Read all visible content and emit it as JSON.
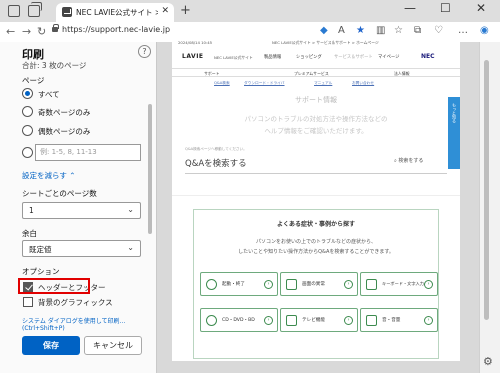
{
  "browser": {
    "tab_title": "NEC LAVIE公式サイト > サービス＆サ",
    "tab_close": "✕",
    "new_tab": "+",
    "url": "https://support.nec-lavie.jp",
    "win_min": "—",
    "win_max": "☐",
    "win_close": "✕",
    "nav_back": "←",
    "nav_forward": "→",
    "nav_reload": "↻",
    "more": "…"
  },
  "print": {
    "title": "印刷",
    "help": "?",
    "total": "合計: 3 枚のページ",
    "pages_label": "ページ",
    "opt_all": "すべて",
    "opt_odd": "奇数ページのみ",
    "opt_even": "偶数ページのみ",
    "custom_placeholder": "例: 1-5, 8, 11-13",
    "fewer_settings": "設定を減らす ⌃",
    "pages_per_sheet_label": "シートごとのページ数",
    "pages_per_sheet_value": "1",
    "margins_label": "余白",
    "margins_value": "既定値",
    "options_label": "オプション",
    "headers_footers": "ヘッダーとフッター",
    "background_graphics": "背景のグラフィックス",
    "system_dialog": "システム ダイアログを使用して印刷... (Ctrl+Shift+P)",
    "save": "保存",
    "cancel": "キャンセル"
  },
  "preview": {
    "top_left_date": "2024/08/14 10:45",
    "top_center": "NEC LAVIE公式サイト > サービス＆サポート > ホームページ",
    "brand": "LAVIE",
    "brand_sub": "NEC LAVIE公式サイト",
    "nav": [
      "製品情報",
      "ショッピング",
      "サービス＆サポート",
      "マイページ"
    ],
    "nec": "NEC",
    "sub_nav": [
      "サポート",
      "プレミアムサービス",
      "法人情報"
    ],
    "links": [
      "Q&A検索",
      "ダウンロード・ドライバ",
      "マニュアル",
      "お問い合わせ"
    ],
    "heading": "サポート情報",
    "lead_1": "パソコンのトラブルの対処方法や操作方法などの",
    "lead_2": "ヘルプ情報をご確認いただけます。",
    "qa_note": "Q&A検索ページへ移動してください。",
    "qa_title": "Q&Aを検索する",
    "search_text": "⌕ 検索をする",
    "side_tab": "もっと知る",
    "card_title": "よくある症状・事例から探す",
    "card_lead_1": "パソコンをお使いの上でのトラブルなどの症状から、",
    "card_lead_2": "したいことや知りたい操作方法からQ&Aを検索することができます。",
    "tiles": [
      "起動・終了",
      "画面の異常",
      "キーボード・文字入力",
      "CD・DVD・BD",
      "テレビ機能",
      "音・音量"
    ],
    "tile_arrow": "›"
  },
  "colors": {
    "accent": "#0062c4",
    "highlight": "#e10000",
    "card_border": "#b9d5c0"
  }
}
